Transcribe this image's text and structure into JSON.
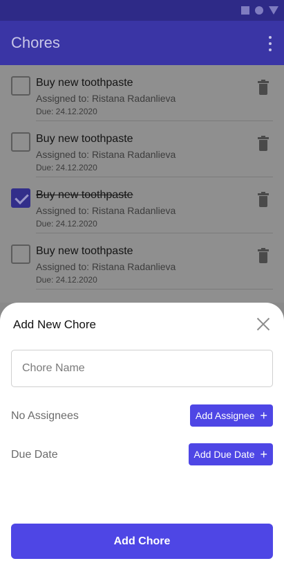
{
  "app": {
    "title": "Chores",
    "overflow_icon": "more-vert-icon"
  },
  "status_bar": {
    "icons": [
      "square-icon",
      "circle-icon",
      "triangle-icon"
    ]
  },
  "chores": [
    {
      "title": "Buy new toothpaste",
      "assigned": "Assigned to: Ristana Radanlieva",
      "due": "Due: 24.12.2020",
      "done": false
    },
    {
      "title": "Buy new toothpaste",
      "assigned": "Assigned to: Ristana Radanlieva",
      "due": "Due: 24.12.2020",
      "done": false
    },
    {
      "title": "Buy new toothpaste",
      "assigned": "Assigned to: Ristana Radanlieva",
      "due": "Due: 24.12.2020",
      "done": true
    },
    {
      "title": "Buy new toothpaste",
      "assigned": "Assigned to: Ristana Radanlieva",
      "due": "Due: 24.12.2020",
      "done": false
    }
  ],
  "sheet": {
    "title": "Add New Chore",
    "name_placeholder": "Chore Name",
    "name_value": "",
    "assignees_label": "No Assignees",
    "add_assignee_label": "Add Assignee",
    "due_label": "Due Date",
    "add_due_label": "Add Due Date",
    "submit_label": "Add Chore"
  },
  "colors": {
    "accent": "#4e46e5",
    "app_bar": "#3a35a5",
    "status_bar": "#2e2a87"
  }
}
